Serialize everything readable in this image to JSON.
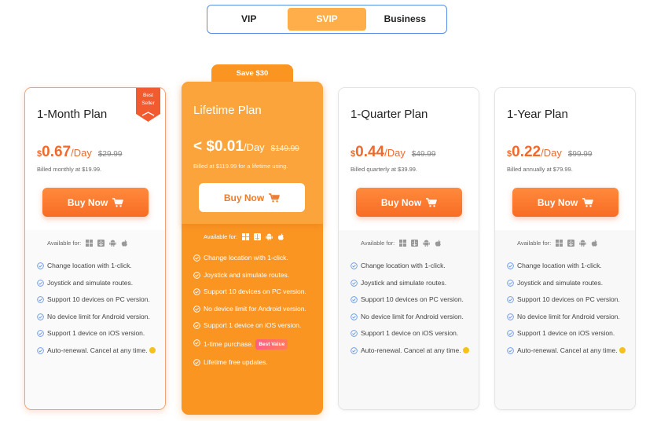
{
  "tabs": [
    {
      "label": "VIP",
      "active": false
    },
    {
      "label": "SVIP",
      "active": true
    },
    {
      "label": "Business",
      "active": false
    }
  ],
  "colors": {
    "accent": "#ffae4a",
    "price": "#ef6a2c",
    "lifetime": "#fb9522",
    "tab_border": "#5b8ee6"
  },
  "available_label": "Available for:",
  "available_os_icons": [
    "windows-icon",
    "macos-finder-icon",
    "android-icon",
    "apple-icon"
  ],
  "plans": {
    "monthly": {
      "ribbon": "Best Seller",
      "title": "1-Month Plan",
      "currency": "$",
      "amount": "0.67",
      "unit": "/Day",
      "old_price": "$29.99",
      "billed": "Billed monthly at $19.99.",
      "buy_label": "Buy Now",
      "features": [
        "Change location with 1-click.",
        "Joystick and simulate routes.",
        "Support 10 devices on PC version.",
        "No device limit for Android version.",
        "Support 1 device on iOS version.",
        "Auto-renewal. Cancel at any time."
      ]
    },
    "lifetime": {
      "save_tag": "Save $30",
      "title": "Lifetime Plan",
      "prefix": "< ",
      "currency": "$",
      "amount": "0.01",
      "unit": "/Day",
      "old_price": "$149.99",
      "billed": "Billed at $119.99 for a lifetime using.",
      "buy_label": "Buy Now",
      "features": [
        "Change location with 1-click.",
        "Joystick and simulate routes.",
        "Support 10 devices on PC version.",
        "No device limit for Android version.",
        "Support 1 device on iOS version.",
        "1-time purchase.",
        "Lifetime free updates."
      ],
      "best_value_badge": "Best Value"
    },
    "quarterly": {
      "title": "1-Quarter Plan",
      "currency": "$",
      "amount": "0.44",
      "unit": "/Day",
      "old_price": "$49.99",
      "billed": "Billed quarterly at $39.99.",
      "buy_label": "Buy Now",
      "features": [
        "Change location with 1-click.",
        "Joystick and simulate routes.",
        "Support 10 devices on PC version.",
        "No device limit for Android version.",
        "Support 1 device on iOS version.",
        "Auto-renewal. Cancel at any time."
      ]
    },
    "yearly": {
      "title": "1-Year Plan",
      "currency": "$",
      "amount": "0.22",
      "unit": "/Day",
      "old_price": "$99.99",
      "billed": "Billed annually at $79.99.",
      "buy_label": "Buy Now",
      "features": [
        "Change location with 1-click.",
        "Joystick and simulate routes.",
        "Support 10 devices on PC version.",
        "No device limit for Android version.",
        "Support 1 device on iOS version.",
        "Auto-renewal. Cancel at any time."
      ]
    }
  }
}
